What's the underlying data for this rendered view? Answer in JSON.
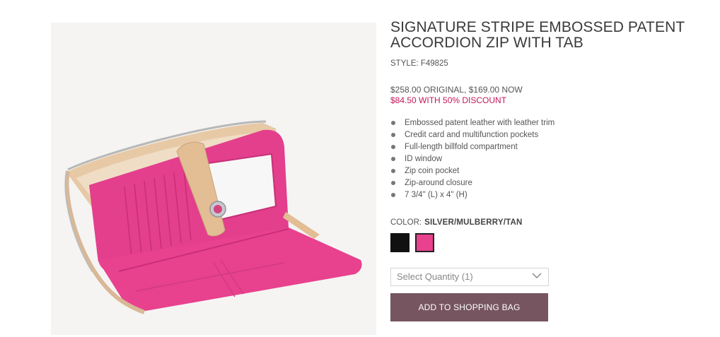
{
  "product": {
    "title_line1": "SIGNATURE STRIPE EMBOSSED PATENT",
    "title_line2": "ACCORDION ZIP WITH TAB",
    "style": "STYLE: F49825",
    "image_alt": "Pink wallet with tan leather tab and silver zip"
  },
  "pricing": {
    "price_line": "$258.00 ORIGINAL,  $169.00 NOW",
    "discount_line": "$84.50 WITH 50% DISCOUNT"
  },
  "features": [
    "Embossed patent leather with leather trim",
    "Credit card and multifunction pockets",
    "Full-length billfold compartment",
    "ID window",
    "Zip coin pocket",
    "Zip-around closure",
    "7 3/4\" (L) x 4\" (H)"
  ],
  "color": {
    "label": "COLOR:",
    "selected": "SILVER/MULBERRY/TAN",
    "swatches": [
      {
        "name": "black",
        "hex": "#111111",
        "selected": false
      },
      {
        "name": "silver/mulberry/tan",
        "hex": "#e8418e",
        "selected": true
      }
    ]
  },
  "quantity": {
    "selected_label": "Select Quantity (1)"
  },
  "cart": {
    "add_label": "ADD TO SHOPPING BAG"
  },
  "colors": {
    "accent_button": "#765560",
    "discount_text": "#c2185b",
    "wallet_pink": "#e8418e",
    "wallet_tan": "#e6c39e"
  }
}
